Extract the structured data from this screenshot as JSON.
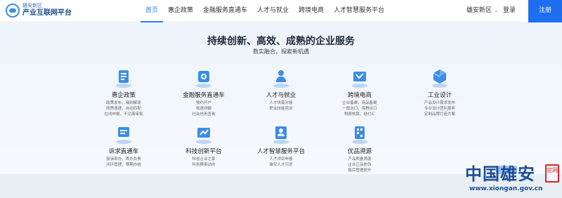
{
  "header": {
    "logo_small": "雄安新区",
    "logo_big": "产业互联网平台",
    "nav": [
      {
        "label": "首页",
        "active": true
      },
      {
        "label": "惠企政策",
        "active": false
      },
      {
        "label": "金融服务直通车",
        "active": false
      },
      {
        "label": "人才与就业",
        "active": false
      },
      {
        "label": "跨境电商",
        "active": false
      },
      {
        "label": "人才智慧服务平台",
        "active": false
      }
    ],
    "region": "雄安新区",
    "login": "登录",
    "register": "注册"
  },
  "hero": {
    "title": "持续创新、高效、成熟的企业服务",
    "subtitle": "数实融合，探索新机遇"
  },
  "services": [
    {
      "name": "惠企政策",
      "desc": [
        "政策发布，细则解读",
        "政策速递，自动匹配",
        "在线申报，不见面审批"
      ],
      "icon": "policy-icon"
    },
    {
      "name": "金融服务直通车",
      "desc": [
        "预约开户",
        "极速测额",
        "社会信用查询"
      ],
      "icon": "finance-icon"
    },
    {
      "name": "人才与就业",
      "desc": [
        "人才供需对接",
        "职业技能培训"
      ],
      "icon": "talent-icon"
    },
    {
      "name": "跨境电商",
      "desc": [
        "企业备案，商品备案",
        "一般出口，保税出口",
        "税费核算，结付汇"
      ],
      "icon": "ecommerce-icon"
    },
    {
      "name": "工业设计",
      "desc": [
        "产品设计需求发布",
        "专业设计团队服务",
        "定制品牌打造方案"
      ],
      "icon": "design-icon"
    },
    {
      "name": "诉求直通车",
      "desc": [
        "接诉即办、首办负责",
        "闭环管理、限期办结"
      ],
      "icon": "appeal-icon"
    },
    {
      "name": "科技创新平台",
      "desc": [
        "科创企业之家",
        "科创赛事动向"
      ],
      "icon": "innovation-icon"
    },
    {
      "name": "人才智慧服务平台",
      "desc": [
        "人才项目申报",
        "雄安人才引进"
      ],
      "icon": "talent-platform-icon"
    },
    {
      "name": "优品溯源",
      "desc": [
        "产品质量溯源",
        "企业正品防伪",
        "售后管理提升"
      ],
      "icon": "traceability-icon"
    }
  ],
  "watermark": {
    "title": "中国雄安",
    "seal": "官网",
    "url": "www.xiongan.gov.cn"
  },
  "colors": {
    "accent": "#2f7df6",
    "register_bg": "#1e6ff0",
    "icon_blue": "#3a8ee6",
    "watermark_blue": "#1c4e97",
    "seal_red": "#d8222b"
  }
}
